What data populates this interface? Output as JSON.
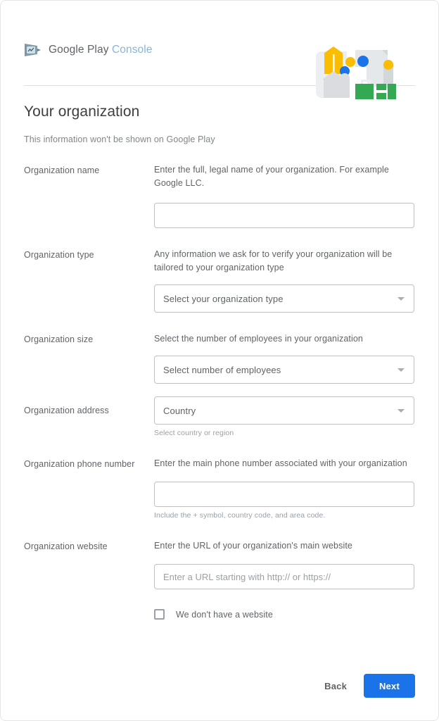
{
  "brand": {
    "logo_icon": "google-play-console-logo-icon",
    "name_primary": "Google Play",
    "name_secondary": "Console",
    "illustration_icon": "organization-buildings-illustration",
    "colors": {
      "yellow": "#fbbc04",
      "blue": "#1a73e8",
      "green": "#34a853",
      "grey": "#dadce0",
      "logo_blue_grey": "#5f7d8c",
      "brand_secondary": "#8ab4d8"
    }
  },
  "header": {
    "title": "Your organization",
    "subtitle": "This information won't be shown on Google Play"
  },
  "form": {
    "rows": [
      {
        "label": "Organization name",
        "description": "Enter the full, legal name of your organization. For example Google LLC.",
        "control": "text",
        "value": "",
        "placeholder": "",
        "hint": ""
      },
      {
        "label": "Organization type",
        "description": "Any information we ask for to verify your organization will be tailored to your organization type",
        "control": "select",
        "value": "Select your organization type",
        "hint": ""
      },
      {
        "label": "Organization size",
        "description": "Select the number of employees in your organization",
        "control": "select",
        "value": "Select number of employees",
        "hint": ""
      },
      {
        "label": "Organization address",
        "description": "",
        "control": "select",
        "value": "Country",
        "hint": "Select country or region"
      },
      {
        "label": "Organization phone number",
        "description": "Enter the main phone number associated with your organization",
        "control": "text",
        "value": "",
        "placeholder": "",
        "hint": "Include the + symbol, country code, and area code."
      },
      {
        "label": "Organization website",
        "description": "Enter the URL of your organization's main website",
        "control": "text",
        "value": "",
        "placeholder": "Enter a URL starting with http:// or https://",
        "hint": ""
      }
    ],
    "no_website_checkbox": {
      "label": "We don't have a website",
      "checked": false
    }
  },
  "actions": {
    "back_label": "Back",
    "next_label": "Next"
  }
}
